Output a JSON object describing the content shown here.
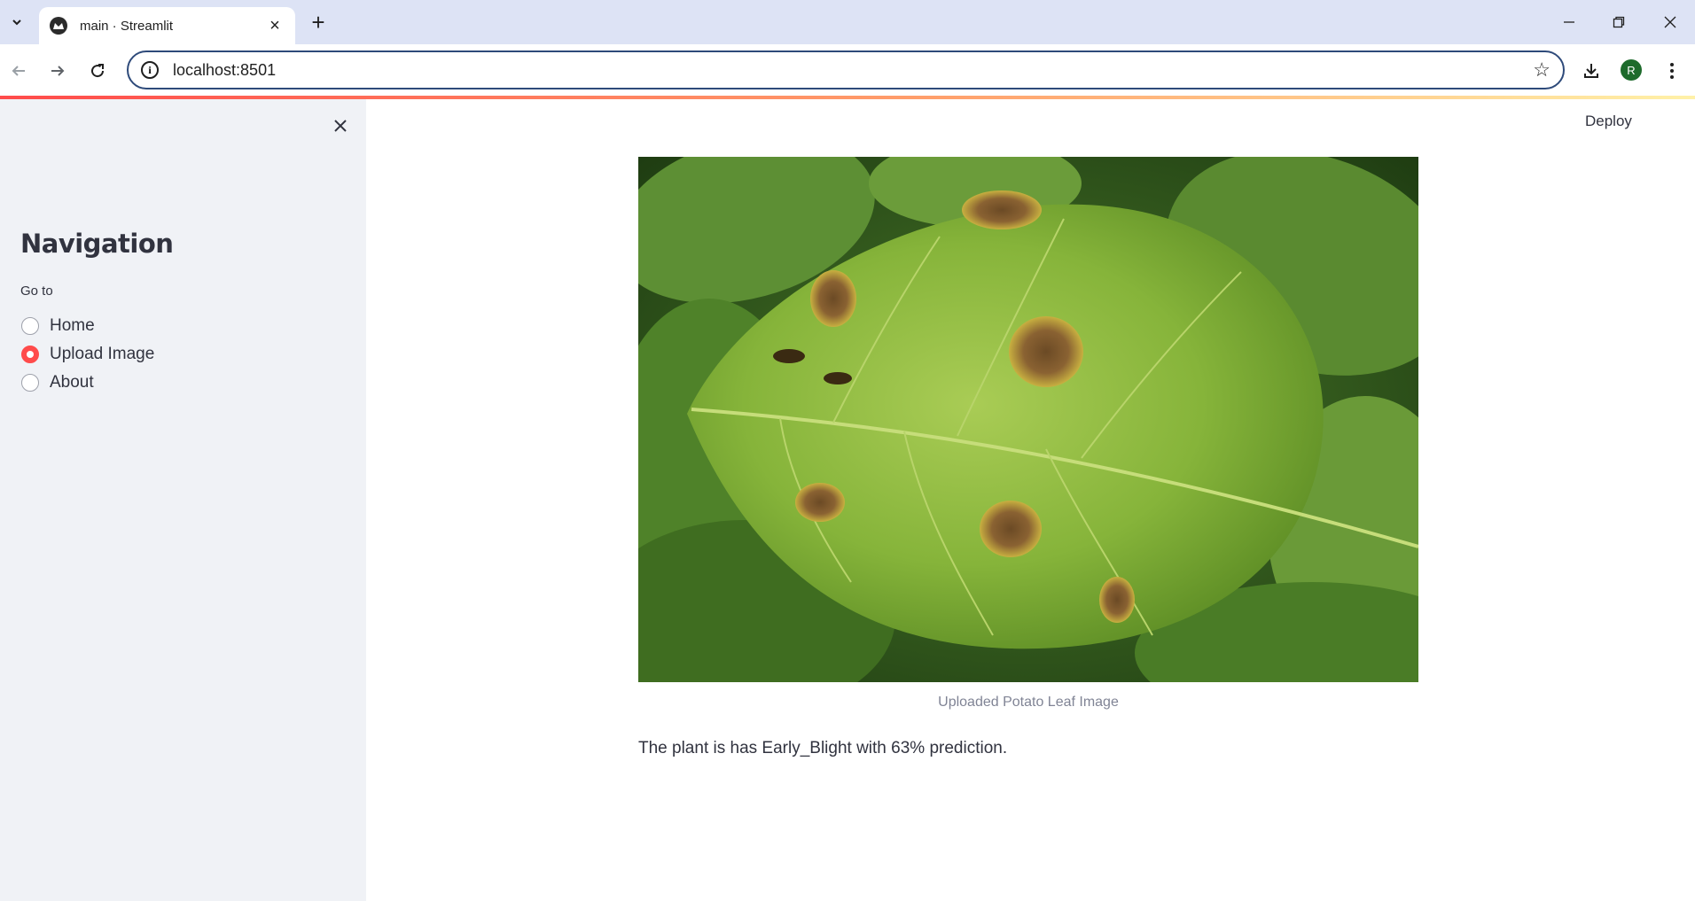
{
  "browser": {
    "tab_title": "main · Streamlit",
    "url": "localhost:8501",
    "profile_initial": "R"
  },
  "colors": {
    "accent": "#ff4b4b",
    "sidebar_bg": "#f0f2f6",
    "text": "#31333f",
    "caption": "#808495"
  },
  "header": {
    "deploy_label": "Deploy"
  },
  "sidebar": {
    "title": "Navigation",
    "radio_label": "Go to",
    "options": [
      {
        "label": "Home",
        "selected": false
      },
      {
        "label": "Upload Image",
        "selected": true
      },
      {
        "label": "About",
        "selected": false
      }
    ]
  },
  "main": {
    "image_caption": "Uploaded Potato Leaf Image",
    "result_text": "The plant is has Early_Blight with 63% prediction."
  }
}
